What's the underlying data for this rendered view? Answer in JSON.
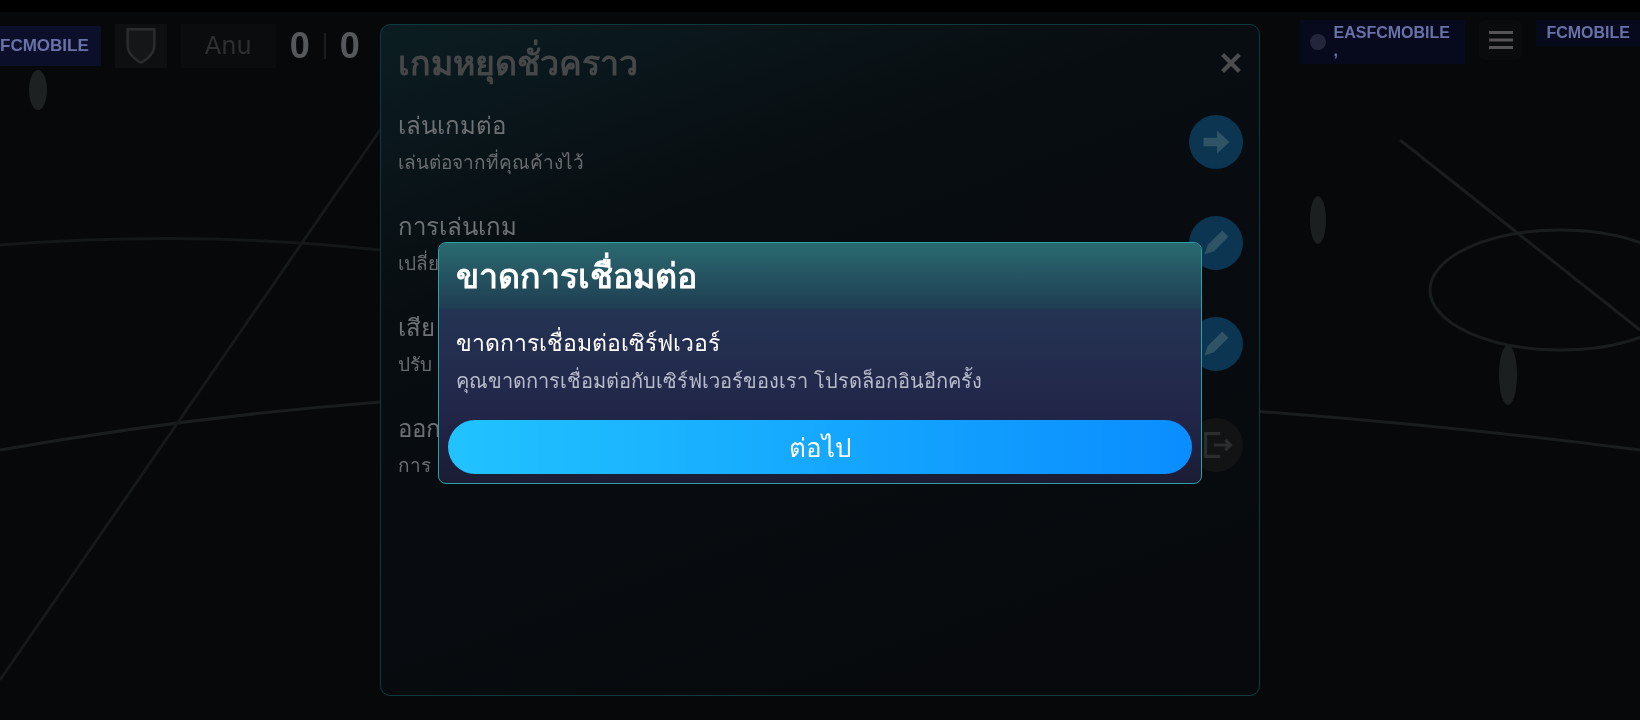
{
  "hud": {
    "left_banner": "FCMOBILE",
    "team_name": "Anu",
    "score_home": "0",
    "score_away": "0",
    "right_banners": [
      "EASFCMOBILE ,",
      "FCMOBILE"
    ]
  },
  "pause_menu": {
    "title": "เกมหยุดชั่วคราว",
    "items": [
      {
        "title": "เล่นเกมต่อ",
        "subtitle": "เล่นต่อจากที่คุณค้างไว้",
        "kind": "arrow"
      },
      {
        "title": "การเล่นเกม",
        "subtitle": "เปลี่ย",
        "kind": "edit"
      },
      {
        "title": "เสีย",
        "subtitle": "ปรับ",
        "kind": "edit"
      },
      {
        "title": "ออก",
        "subtitle": "การ",
        "kind": "exit"
      }
    ]
  },
  "dialog": {
    "title": "ขาดการเชื่อมต่อ",
    "heading": "ขาดการเชื่อมต่อเซิร์ฟเวอร์",
    "message": "คุณขาดการเชื่อมต่อกับเซิร์ฟเวอร์ของเรา โปรดล็อกอินอีกครั้ง",
    "button": "ต่อไป"
  }
}
